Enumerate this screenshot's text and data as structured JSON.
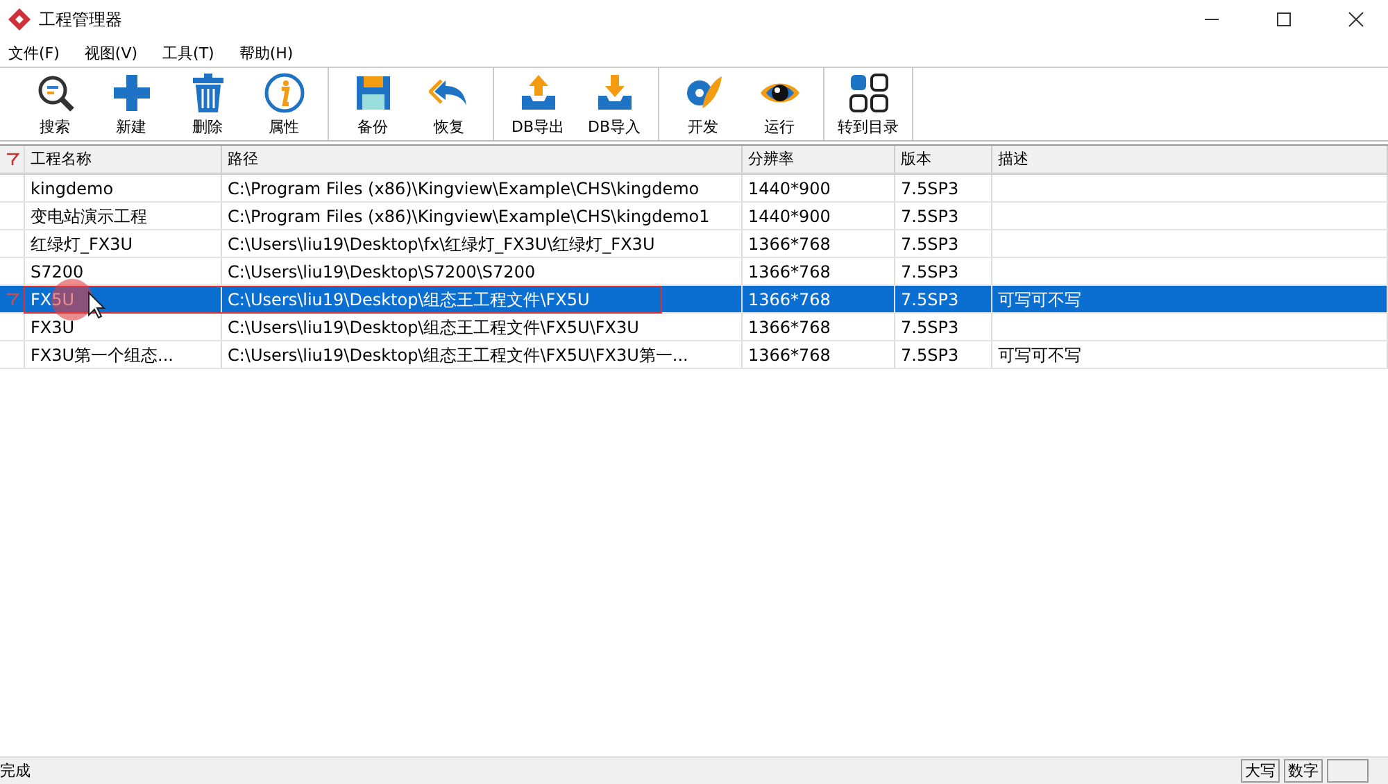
{
  "window": {
    "title": "工程管理器"
  },
  "menu": [
    "文件(F)",
    "视图(V)",
    "工具(T)",
    "帮助(H)"
  ],
  "toolbar": [
    [
      {
        "label": "搜索"
      },
      {
        "label": "新建"
      },
      {
        "label": "删除"
      },
      {
        "label": "属性"
      }
    ],
    [
      {
        "label": "备份"
      },
      {
        "label": "恢复"
      }
    ],
    [
      {
        "label": "DB导出"
      },
      {
        "label": "DB导入"
      }
    ],
    [
      {
        "label": "开发"
      },
      {
        "label": "运行"
      }
    ],
    [
      {
        "label": "转到目录"
      }
    ]
  ],
  "table": {
    "columns": [
      "工程名称",
      "路径",
      "分辨率",
      "版本",
      "描述"
    ],
    "rows": [
      {
        "cells": [
          "kingdemo",
          "C:\\Program Files (x86)\\Kingview\\Example\\CHS\\kingdemo",
          "1440*900",
          "7.5SP3",
          ""
        ],
        "selected": false
      },
      {
        "cells": [
          "变电站演示工程",
          "C:\\Program Files (x86)\\Kingview\\Example\\CHS\\kingdemo1",
          "1440*900",
          "7.5SP3",
          ""
        ],
        "selected": false
      },
      {
        "cells": [
          "红绿灯_FX3U",
          "C:\\Users\\liu19\\Desktop\\fx\\红绿灯_FX3U\\红绿灯_FX3U",
          "1366*768",
          "7.5SP3",
          ""
        ],
        "selected": false
      },
      {
        "cells": [
          "S7200",
          "C:\\Users\\liu19\\Desktop\\S7200\\S7200",
          "1366*768",
          "7.5SP3",
          ""
        ],
        "selected": false
      },
      {
        "cells": [
          "FX5U",
          "C:\\Users\\liu19\\Desktop\\组态王工程文件\\FX5U",
          "1366*768",
          "7.5SP3",
          "可写可不写"
        ],
        "selected": true
      },
      {
        "cells": [
          "FX3U",
          "C:\\Users\\liu19\\Desktop\\组态王工程文件\\FX5U\\FX3U",
          "1366*768",
          "7.5SP3",
          ""
        ],
        "selected": false
      },
      {
        "cells": [
          "FX3U第一个组态...",
          "C:\\Users\\liu19\\Desktop\\组态王工程文件\\FX5U\\FX3U第一...",
          "1366*768",
          "7.5SP3",
          "可写可不写"
        ],
        "selected": false
      }
    ]
  },
  "status_bar": {
    "text": "完成",
    "indicators": [
      "大写",
      "数字"
    ]
  }
}
